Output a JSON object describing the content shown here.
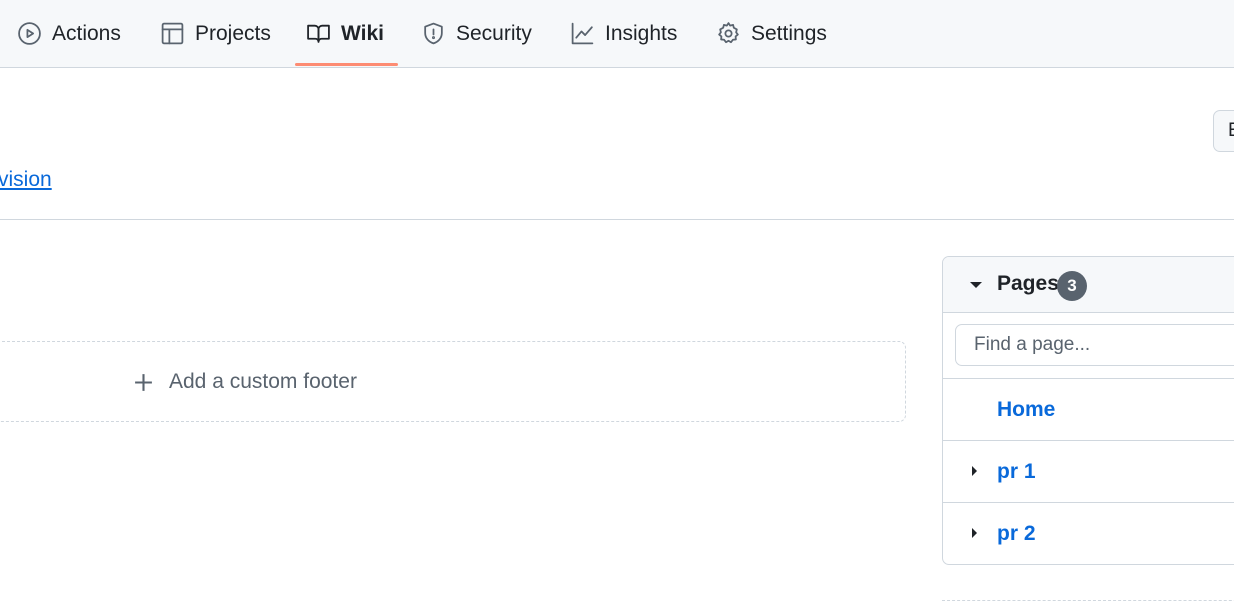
{
  "nav": {
    "tabs": [
      {
        "label": "Actions",
        "icon": "play-circle-icon"
      },
      {
        "label": "Projects",
        "icon": "table-icon"
      },
      {
        "label": "Wiki",
        "icon": "book-icon",
        "active": true
      },
      {
        "label": "Security",
        "icon": "shield-icon"
      },
      {
        "label": "Insights",
        "icon": "graph-icon"
      },
      {
        "label": "Settings",
        "icon": "gear-icon"
      }
    ]
  },
  "header": {
    "edit_button_label": "E",
    "revision_link": "vision"
  },
  "footer": {
    "add_label": "Add a custom footer"
  },
  "pages": {
    "title": "Pages",
    "count": "3",
    "search_placeholder": "Find a page...",
    "items": [
      {
        "label": "Home",
        "expandable": false
      },
      {
        "label": "pr 1",
        "expandable": true
      },
      {
        "label": "pr 2",
        "expandable": true
      }
    ]
  },
  "colors": {
    "link": "#0969da",
    "active_underline": "#fd8c73",
    "border": "#d0d7de",
    "badge": "#59636e"
  }
}
